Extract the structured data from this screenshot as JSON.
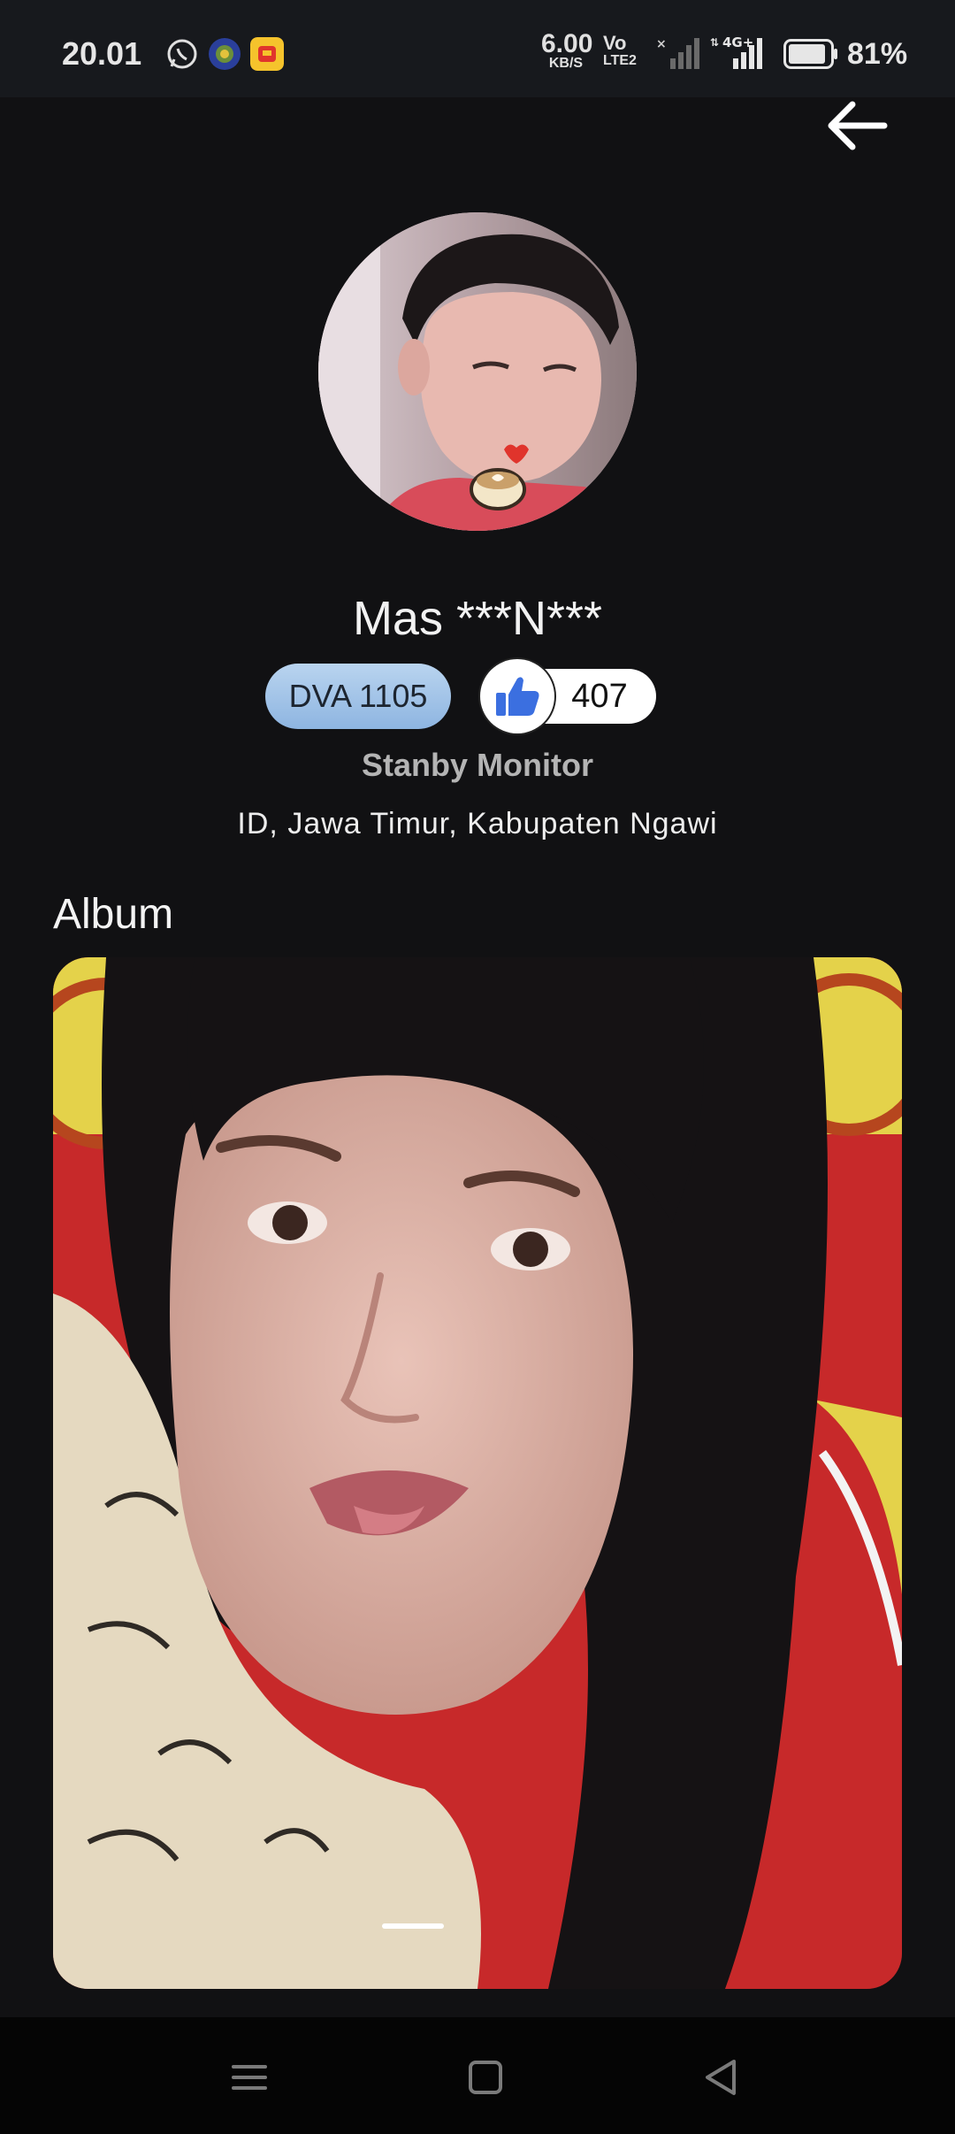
{
  "status_bar": {
    "time": "20.01",
    "net_speed": "6.00",
    "net_speed_unit": "KB/S",
    "volte_top": "Vo",
    "volte_bottom": "LTE2",
    "network_type": "4G+",
    "battery_percent": "81%",
    "battery_level": 0.81,
    "icons": [
      "whatsapp-icon",
      "app-icon",
      "app-icon-m3",
      "signal-sim1-icon",
      "signal-sim2-icon",
      "battery-icon"
    ]
  },
  "header": {
    "back_icon": "arrow-left-icon"
  },
  "profile": {
    "name": "Mas ***N***",
    "level_badge": "DVA 1105",
    "like_icon": "thumbs-up-icon",
    "like_count": "407",
    "status": "Stanby Monitor",
    "location": "ID, Jawa Timur, Kabupaten Ngawi"
  },
  "album": {
    "title": "Album",
    "photo_count_visible": 1,
    "active_index": 0
  },
  "nav_bar": {
    "buttons": [
      "menu-icon",
      "home-icon",
      "back-triangle-icon"
    ]
  },
  "colors": {
    "background": "#111113",
    "badge_blue": "#9dbfe6",
    "like_blue": "#3b6fe0"
  }
}
